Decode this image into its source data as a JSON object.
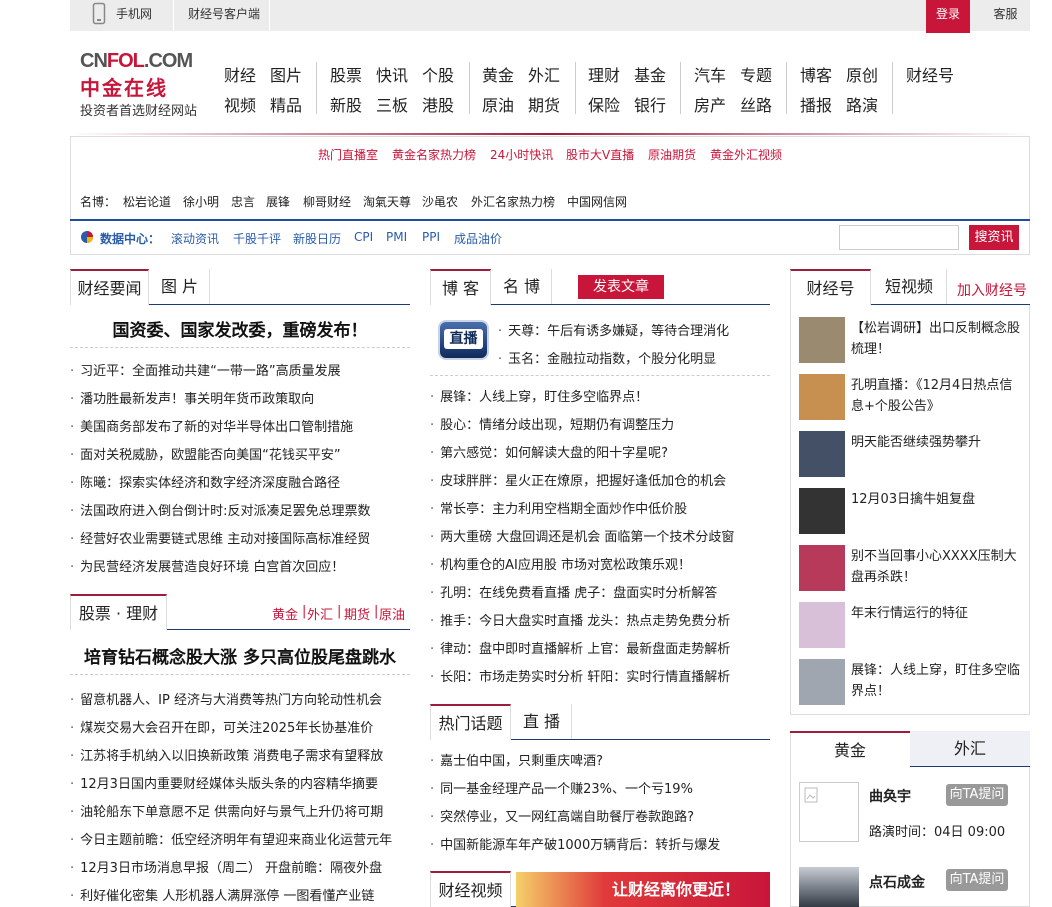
{
  "topbar": {
    "mobile": "手机网",
    "client": "财经号客户端",
    "login": "登录",
    "kefu": "客服"
  },
  "logo": {
    "brand_cn": "CN",
    "brand_fol": "FOL",
    "brand_com": ".COM",
    "brand_zh": "中金在线",
    "slogan": "投资者首选财经网站"
  },
  "nav": {
    "row1": [
      "财经",
      "图片",
      "股票",
      "快讯",
      "个股",
      "黄金",
      "外汇",
      "理财",
      "基金",
      "汽车",
      "专题",
      "博客",
      "原创",
      "财经号"
    ],
    "row2": [
      "视频",
      "精品",
      "新股",
      "三板",
      "港股",
      "原油",
      "期货",
      "保险",
      "银行",
      "房产",
      "丝路",
      "播报",
      "路演"
    ]
  },
  "hot_links": [
    "热门直播室",
    "黄金名家热力榜",
    "24小时快讯",
    "股市大V直播",
    "原油期货",
    "黄金外汇视频"
  ],
  "mingbo": {
    "label": "名博：",
    "items": [
      "松岩论道",
      "徐小明",
      "忠言",
      "展锋",
      "柳哥财经",
      "淘氣天尊",
      "沙黾农",
      "外汇名家热力榜",
      "中国网信网"
    ]
  },
  "data_center": {
    "label": "数据中心：",
    "items": [
      "滚动资讯",
      "千股千评",
      "新股日历",
      "CPI",
      "PMI",
      "PPI",
      "成品油价"
    ],
    "search_button": "搜资讯"
  },
  "finance": {
    "tabs": [
      "财经要闻",
      "图 片"
    ],
    "headline": "国资委、国家发改委，重磅发布！",
    "items": [
      "习近平：全面推动共建“一带一路”高质量发展",
      "潘功胜最新发声！事关明年货币政策取向",
      "美国商务部发布了新的对华半导体出口管制措施",
      "面对关税威胁，欧盟能否向美国“花钱买平安”",
      "陈曦：探索实体经济和数字经济深度融合路径",
      "法国政府进入倒台倒计时:反对派凑足罢免总理票数",
      "经营好农业需要链式思维  主动对接国际高标准经贸",
      "为民营经济发展营造良好环境  白宫首次回应！"
    ]
  },
  "stocks": {
    "tab": "股票 · 理财",
    "links": [
      "黄金",
      "外汇",
      "期货",
      "原油"
    ],
    "headline": "培育钻石概念股大涨 多只高位股尾盘跳水",
    "items": [
      "留意机器人、IP 经济与大消费等热门方向轮动性机会",
      "煤炭交易大会召开在即，可关注2025年长协基准价",
      "江苏将手机纳入以旧换新政策 消费电子需求有望释放",
      "12月3日国内重要财经媒体头版头条的内容精华摘要",
      "油轮船东下单意愿不足 供需向好与景气上升仍将可期",
      "今日主题前瞻：低空经济明年有望迎来商业化运营元年",
      "12月3日市场消息早报（周二）  开盘前瞻：隔夜外盘",
      "利好催化密集 人形机器人满屏涨停 一图看懂产业链"
    ]
  },
  "blog": {
    "tabs": [
      "博 客",
      "名 博"
    ],
    "publish_button": "发表文章",
    "live_badge": "直播",
    "live_items": [
      "天尊：午后有诱多嫌疑，等待合理消化",
      "玉名：金融拉动指数，个股分化明显"
    ],
    "items": [
      "展锋：人线上穿，盯住多空临界点！",
      "股心：情绪分歧出现，短期仍有调整压力",
      "第六感觉：如何解读大盘的阳十字星呢?",
      "皮球胖胖：星火正在燎原，把握好逢低加仓的机会",
      "常长亭：主力利用空档期全面炒作中低价股",
      "两大重磅 大盘回调还是机会  面临第一个技术分歧窗",
      "机构重仓的AI应用股  市场对宽松政策乐观！",
      "孔明：在线免费看直播  虎子：盘面实时分析解答",
      "推手：今日大盘实时直播  龙头：热点走势免费分析",
      "律动：盘中即时直播解析  上官：最新盘面走势解析",
      "长阳：市场走势实时分析  轩阳：实时行情直播解析"
    ]
  },
  "hot_topics": {
    "tabs": [
      "热门话题",
      "直 播"
    ],
    "items": [
      "嘉士伯中国，只剩重庆啤酒?",
      "同一基金经理产品一个赚23%、一个亏19%",
      "突然停业，又一网红高端自助餐厅卷款跑路?",
      "中国新能源车年产破1000万辆背后：转折与爆发"
    ]
  },
  "video": {
    "tab": "财经视频",
    "banner_text": "让财经离你更近！"
  },
  "caijinghao": {
    "tabs": [
      "财经号",
      "短视频"
    ],
    "join": "加入财经号",
    "items": [
      "【松岩调研】出口反制概念股梳理！",
      "孔明直播：《12月4日热点信息+个股公告》",
      "明天能否继续强势攀升",
      "12月03日擒牛姐复盘",
      "别不当回事小心XXXX压制大盘再杀跌！",
      "年末行情运行的特征",
      "展锋：人线上穿，盯住多空临界点！"
    ]
  },
  "gold": {
    "tabs": [
      "黄金",
      "外汇"
    ],
    "experts": [
      {
        "name": "曲奂宇",
        "ask": "向TA提问",
        "time": "路演时间：04日 09:00"
      },
      {
        "name": "点石成金",
        "ask": "向TA提问"
      }
    ]
  }
}
